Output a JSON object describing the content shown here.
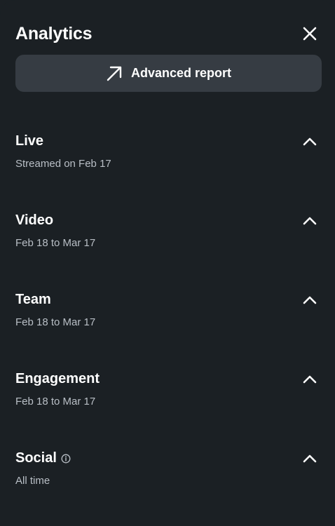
{
  "header": {
    "title": "Analytics",
    "close_icon": "close-icon"
  },
  "report_button": {
    "label": "Advanced report",
    "icon": "arrow-up-right-icon"
  },
  "sections": [
    {
      "title": "Live",
      "subtitle": "Streamed on Feb 17",
      "icon": "chevron-up-icon"
    },
    {
      "title": "Video",
      "subtitle": "Feb 18 to Mar 17",
      "icon": "chevron-up-icon"
    },
    {
      "title": "Team",
      "subtitle": "Feb 18 to Mar 17",
      "icon": "chevron-up-icon"
    },
    {
      "title": "Engagement",
      "subtitle": "Feb 18 to Mar 17",
      "icon": "chevron-up-icon"
    },
    {
      "title": "Social",
      "subtitle": "All time",
      "icon": "chevron-up-icon",
      "info_icon": "info-icon"
    }
  ],
  "colors": {
    "background": "#1b2024",
    "button_bg": "#363c43",
    "text_primary": "#ffffff",
    "text_secondary": "#b9bfc6"
  }
}
